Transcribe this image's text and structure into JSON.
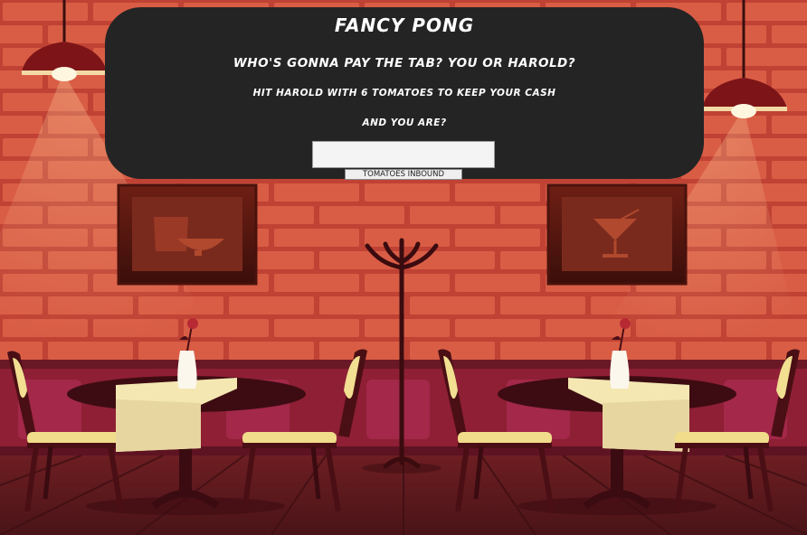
{
  "game": {
    "title": "FANCY PONG",
    "question": "WHO'S GONNA PAY THE TAB? YOU OR HAROLD?",
    "instruction": "HIT HAROLD WITH 6 TOMATOES TO KEEP YOUR CASH",
    "name_prompt": "AND YOU ARE?",
    "name_value": "",
    "start_button": "TOMATOES INBOUND"
  },
  "colors": {
    "panel": "#242424",
    "wall": "#c9483a",
    "brick": "#e86a4e",
    "wainscot": "#8e1f34",
    "floor": "#5a1a1f",
    "tablecloth": "#f4e7b2",
    "lamp_shade": "#7d1518"
  },
  "icons": [
    "ceiling-lamp-icon",
    "wine-glass-art-icon",
    "cocktail-art-icon",
    "coat-rack-icon",
    "rose-vase-icon",
    "chair-icon",
    "round-table-icon"
  ]
}
